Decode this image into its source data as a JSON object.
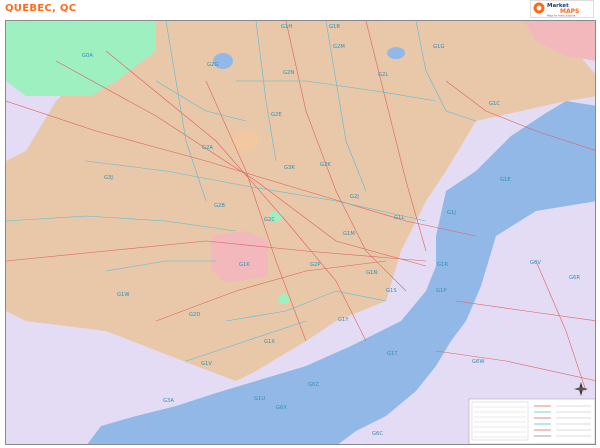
{
  "title": "QUEBEC, QC",
  "logo": {
    "brand_top": "Market",
    "brand_bottom": "MAPS",
    "tagline": "Maps for every purpose"
  },
  "colors": {
    "land_tan": "#e8c8a8",
    "land_green": "#9ef0c0",
    "land_purple": "#e4dcf4",
    "land_pink": "#f2b8bc",
    "water": "#92b8e8",
    "boundary": "#59b9d9",
    "roads": "#e06060",
    "zip_label": "#2f8fb8",
    "title": "#ff6a1a"
  },
  "zip_codes": [
    {
      "code": "G0A"
    },
    {
      "code": "G1H"
    },
    {
      "code": "G1B"
    },
    {
      "code": "G2G"
    },
    {
      "code": "G2M"
    },
    {
      "code": "G2N"
    },
    {
      "code": "G2L"
    },
    {
      "code": "G1G"
    },
    {
      "code": "G2E"
    },
    {
      "code": "G1C"
    },
    {
      "code": "G2A"
    },
    {
      "code": "G2K"
    },
    {
      "code": "G3J"
    },
    {
      "code": "G1E"
    },
    {
      "code": "G3K"
    },
    {
      "code": "G2J"
    },
    {
      "code": "G2B"
    },
    {
      "code": "G1L"
    },
    {
      "code": "G2C"
    },
    {
      "code": "G1J"
    },
    {
      "code": "G1M"
    },
    {
      "code": "G1R"
    },
    {
      "code": "G2P"
    },
    {
      "code": "G1N"
    },
    {
      "code": "G6V"
    },
    {
      "code": "G1K"
    },
    {
      "code": "G6R"
    },
    {
      "code": "G1S"
    },
    {
      "code": "G1W"
    },
    {
      "code": "G1P"
    },
    {
      "code": "G1Y"
    },
    {
      "code": "G2D"
    },
    {
      "code": "G1X"
    },
    {
      "code": "G1T"
    },
    {
      "code": "G6W"
    },
    {
      "code": "G1V"
    },
    {
      "code": "G6Z"
    },
    {
      "code": "G1U"
    },
    {
      "code": "G6X"
    },
    {
      "code": "G3A"
    },
    {
      "code": "G6C"
    }
  ],
  "features": {
    "compass": "north-arrow",
    "legend": "legend-panel"
  }
}
